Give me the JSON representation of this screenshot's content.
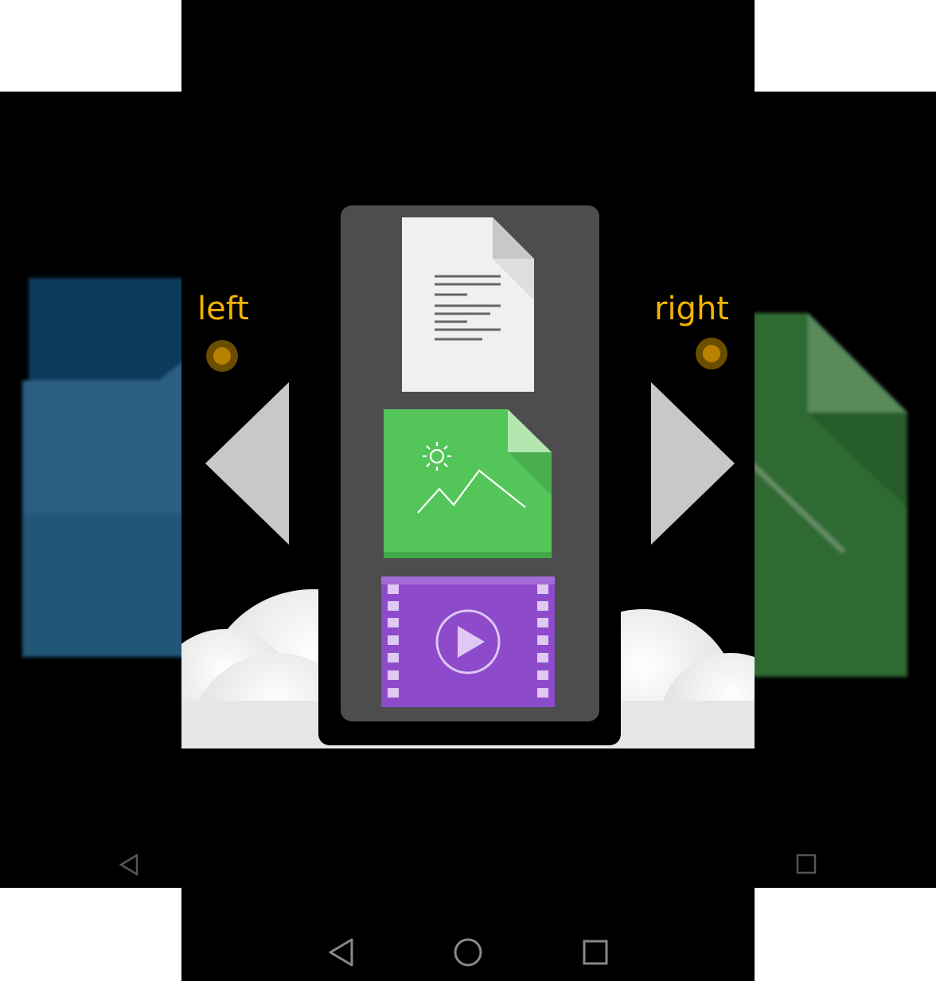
{
  "labels": {
    "left": "left",
    "right": "right"
  },
  "icons": {
    "background_left": "folder-icon",
    "background_right": "file-icon",
    "document": "document-file-icon",
    "image": "image-file-icon",
    "video": "video-file-icon",
    "arrow_left": "arrow-left-icon",
    "arrow_right": "arrow-right-icon"
  },
  "colors": {
    "label": "#f5b300",
    "arrow": "#c8c8c8",
    "panel": "#4d4d4d",
    "image_file": "#54c659",
    "video_file": "#8d4bcb",
    "folder": "#2a5f84",
    "green_file": "#2e6a32"
  },
  "nav_bar": {
    "items": [
      "back-icon",
      "home-icon",
      "recents-icon"
    ]
  },
  "back_nav_bar": {
    "items": [
      "back-icon",
      "recents-icon"
    ]
  }
}
